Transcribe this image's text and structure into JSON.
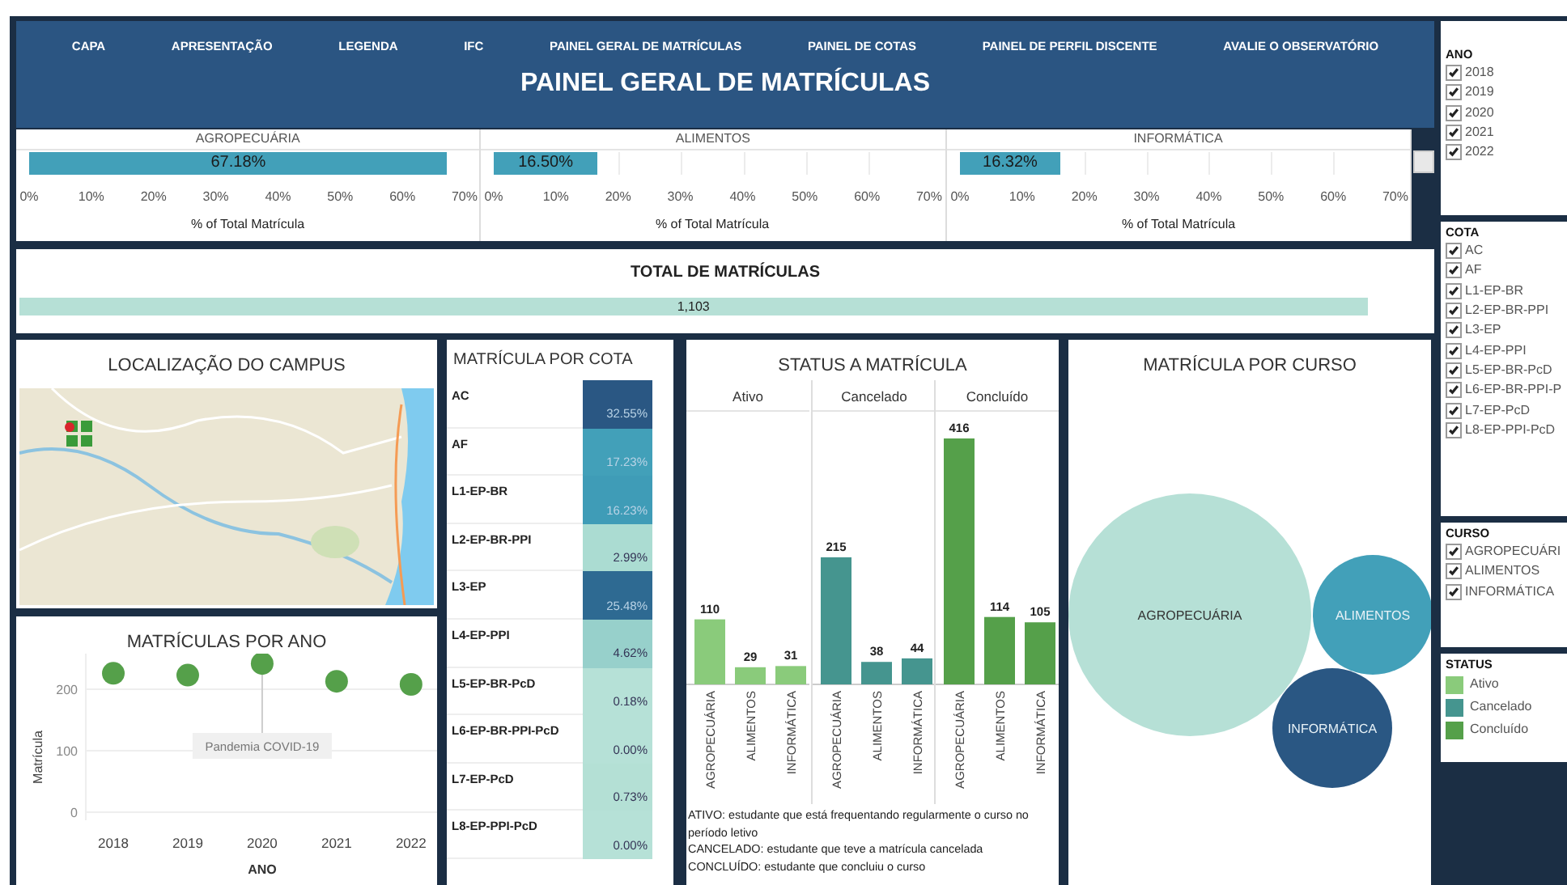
{
  "nav": {
    "items": [
      "CAPA",
      "APRESENTAÇÃO",
      "LEGENDA",
      "IFC",
      "PAINEL GERAL DE MATRÍCULAS",
      "PAINEL DE COTAS",
      "PAINEL DE PERFIL DISCENTE",
      "AVALIE O OBSERVATÓRIO"
    ]
  },
  "title": "PAINEL GERAL DE MATRÍCULAS",
  "course_share": [
    {
      "course": "AGROPECUÁRIA",
      "level": 0.9597,
      "reading": "67.18%",
      "axis_ticks": [
        "0%",
        "10%",
        "20%",
        "30%",
        "40%",
        "50%",
        "60%",
        "70%"
      ],
      "axis_title": "% of Total Matrícula"
    },
    {
      "course": "ALIMENTOS",
      "level": 0.2357,
      "reading": "16.50%",
      "axis_ticks": [
        "0%",
        "10%",
        "20%",
        "30%",
        "40%",
        "50%",
        "60%",
        "70%"
      ],
      "axis_title": "% of Total Matrícula"
    },
    {
      "course": "INFORMÁTICA",
      "level": 0.2331,
      "reading": "16.32%",
      "axis_ticks": [
        "0%",
        "10%",
        "20%",
        "30%",
        "40%",
        "50%",
        "60%",
        "70%"
      ],
      "axis_title": "% of Total Matrícula"
    }
  ],
  "total": {
    "title": "TOTAL DE MATRÍCULAS",
    "value": "1,103",
    "level": 0.955
  },
  "map": {
    "title": "LOCALIZAÇÃO DO CAMPUS"
  },
  "year_chart": {
    "title": "MATRÍCULAS POR ANO",
    "chart_data": {
      "type": "scatter",
      "x": [
        2018,
        2019,
        2020,
        2021,
        2022
      ],
      "values": [
        226,
        223,
        242,
        213,
        208
      ],
      "xlim": [
        2017.63,
        2022.35
      ],
      "ylim": [
        0,
        258
      ],
      "yticks": [
        0,
        100,
        200
      ],
      "xticks": [
        2018,
        2019,
        2020,
        2021,
        2022
      ],
      "xlabel": "ANO",
      "ylabel": "Matrícula",
      "annotations": [
        {
          "x": 2020,
          "text": "Pandemia COVID-19"
        }
      ]
    }
  },
  "cota": {
    "title": "MATRÍCULA POR COTA",
    "rows": [
      {
        "label": "AC",
        "value": "32.55%",
        "color": "#2a5783"
      },
      {
        "label": "AF",
        "value": "17.23%",
        "color": "#42a0b9"
      },
      {
        "label": "L1-EP-BR",
        "value": "16.23%",
        "color": "#3f9cb7"
      },
      {
        "label": "L2-EP-BR-PPI",
        "value": "2.99%",
        "color": "#abdcd2"
      },
      {
        "label": "L3-EP",
        "value": "25.48%",
        "color": "#2e6a92"
      },
      {
        "label": "L4-EP-PPI",
        "value": "4.62%",
        "color": "#97d0cb"
      },
      {
        "label": "L5-EP-BR-PcD",
        "value": "0.18%",
        "color": "#b6e1d7"
      },
      {
        "label": "L6-EP-BR-PPI-PcD",
        "value": "0.00%",
        "color": "#b6e1d7"
      },
      {
        "label": "L7-EP-PcD",
        "value": "0.73%",
        "color": "#b4e0d5"
      },
      {
        "label": "L8-EP-PPI-PcD",
        "value": "0.00%",
        "color": "#b6e1d7"
      }
    ]
  },
  "status": {
    "title": "STATUS A MATRÍCULA",
    "facets": [
      {
        "status": "Ativo",
        "color": "#8acb7b",
        "chart_data": {
          "type": "bar",
          "categories": [
            "AGROPECUÁRIA",
            "ALIMENTOS",
            "INFORMÁTICA"
          ],
          "values": [
            110,
            29,
            31
          ],
          "data_labels": true
        }
      },
      {
        "status": "Cancelado",
        "color": "#45958f",
        "chart_data": {
          "type": "bar",
          "categories": [
            "AGROPECUÁRIA",
            "ALIMENTOS",
            "INFORMÁTICA"
          ],
          "values": [
            215,
            38,
            44
          ],
          "data_labels": true
        }
      },
      {
        "status": "Concluído",
        "color": "#55a04a",
        "chart_data": {
          "type": "bar",
          "categories": [
            "AGROPECUÁRIA",
            "ALIMENTOS",
            "INFORMÁTICA"
          ],
          "values": [
            416,
            114,
            105
          ],
          "data_labels": true
        }
      }
    ],
    "notes": [
      "ATIVO: estudante que está frequentando regularmente o curso no período letivo",
      "CANCELADO: estudante que teve a matrícula cancelada",
      "CONCLUÍDO: estudante que concluiu o curso"
    ]
  },
  "curso": {
    "title": "MATRÍCULA POR CURSO",
    "bubbles": [
      {
        "label": "AGROPECUÁRIA",
        "color": "#b6e0d6"
      },
      {
        "label": "ALIMENTOS",
        "color": "#42a0b9"
      },
      {
        "label": "INFORMÁTICA",
        "color": "#2a5783"
      }
    ]
  },
  "filters": [
    {
      "title": "ANO",
      "kind": "checklist",
      "items": [
        {
          "label": "2018",
          "checked": true
        },
        {
          "label": "2019",
          "checked": true
        },
        {
          "label": "2020",
          "checked": true
        },
        {
          "label": "2021",
          "checked": true
        },
        {
          "label": "2022",
          "checked": true
        }
      ]
    },
    {
      "title": "COTA",
      "kind": "checklist",
      "items": [
        {
          "label": "AC",
          "checked": true
        },
        {
          "label": "AF",
          "checked": true
        },
        {
          "label": "L1-EP-BR",
          "checked": true
        },
        {
          "label": "L2-EP-BR-PPI",
          "checked": true
        },
        {
          "label": "L3-EP",
          "checked": true
        },
        {
          "label": "L4-EP-PPI",
          "checked": true
        },
        {
          "label": "L5-EP-BR-PcD",
          "checked": true
        },
        {
          "label": "L6-EP-BR-PPI-P",
          "checked": true
        },
        {
          "label": "L7-EP-PcD",
          "checked": true
        },
        {
          "label": "L8-EP-PPI-PcD",
          "checked": true
        }
      ]
    },
    {
      "title": "CURSO",
      "kind": "checklist",
      "items": [
        {
          "label": "AGROPECUÁRI",
          "checked": true
        },
        {
          "label": "ALIMENTOS",
          "checked": true
        },
        {
          "label": "INFORMÁTICA",
          "checked": true
        }
      ]
    },
    {
      "title": "STATUS",
      "kind": "legend",
      "items": [
        {
          "label": "Ativo",
          "color": "#8acb7b"
        },
        {
          "label": "Cancelado",
          "color": "#45958f"
        },
        {
          "label": "Concluído",
          "color": "#55a04a"
        }
      ]
    }
  ]
}
